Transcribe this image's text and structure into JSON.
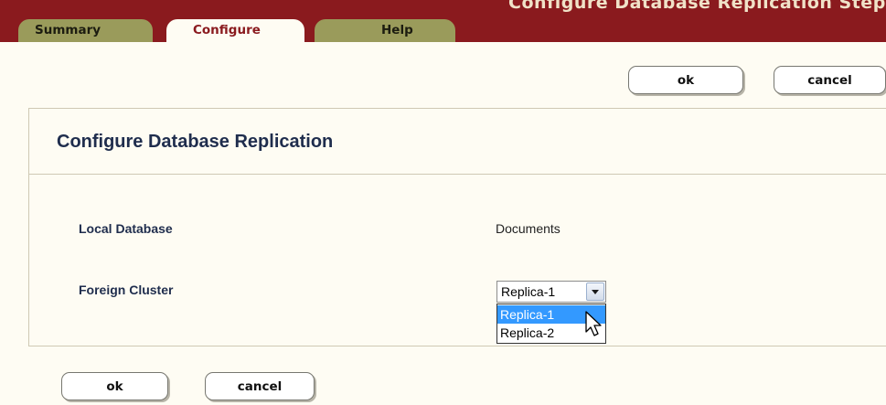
{
  "header": {
    "title": "Configure Database Replication Step"
  },
  "tabs": [
    {
      "label": "Summary"
    },
    {
      "label": "Configure"
    },
    {
      "label": "Help"
    }
  ],
  "top_actions": {
    "ok_label": "ok",
    "cancel_label": "cancel"
  },
  "panel": {
    "title": "Configure Database Replication",
    "local_database": {
      "label": "Local Database",
      "value": "Documents"
    },
    "foreign_cluster": {
      "label": "Foreign Cluster",
      "selected": "Replica-1",
      "options": [
        "Replica-1",
        "Replica-2"
      ]
    }
  },
  "bottom_actions": {
    "ok_label": "ok",
    "cancel_label": "cancel"
  },
  "colors": {
    "header_maroon": "#8a1a1e",
    "tab_olive": "#9a9b5b",
    "page_background": "#fefcf3",
    "title_navy": "#1f2d4d",
    "selection_blue": "#3399ff"
  }
}
